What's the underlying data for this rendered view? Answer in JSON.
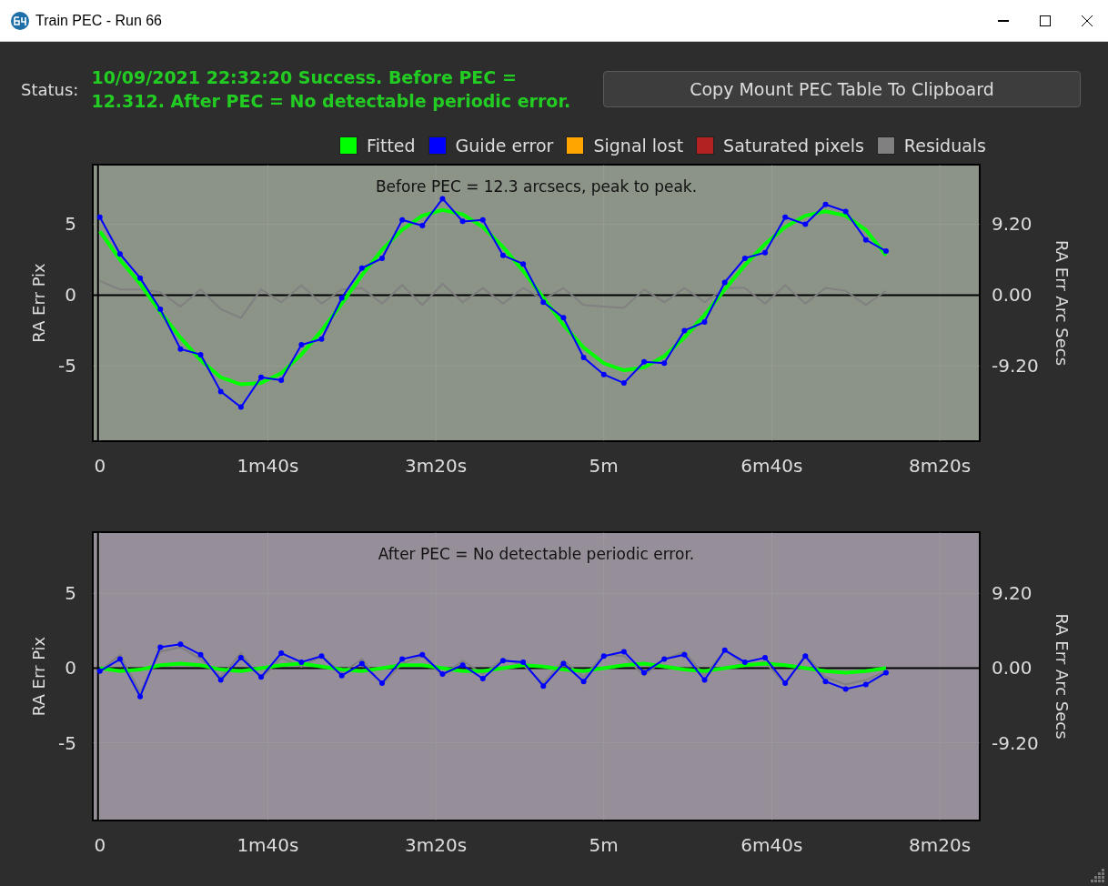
{
  "window": {
    "title": "Train PEC - Run 66"
  },
  "status": {
    "label": "Status:",
    "message": "10/09/2021 22:32:20 Success. Before PEC = 12.312. After PEC = No detectable periodic error."
  },
  "copy_button": {
    "label": "Copy Mount PEC Table To Clipboard"
  },
  "charts": [
    {
      "right_axis": {
        "label": "RA Err Arc Secs",
        "ticks": [
          "9.20",
          "0.00",
          "-9.20"
        ]
      },
      "chart_data": {
        "type": "line",
        "grid": true,
        "title": "Before PEC = 12.3 arcsecs, peak to peak.",
        "ylabel": "RA Err Pix",
        "xlim": [
          -0.07,
          8.73
        ],
        "ylim": [
          -10.3,
          9.2
        ],
        "xticks": [
          {
            "value": 0,
            "label": "0"
          },
          {
            "value": 1.6667,
            "label": "1m40s"
          },
          {
            "value": 3.3333,
            "label": "3m20s"
          },
          {
            "value": 5,
            "label": "5m"
          },
          {
            "value": 6.6667,
            "label": "6m40s"
          },
          {
            "value": 8.3333,
            "label": "8m20s"
          }
        ],
        "yticks": [
          -5,
          0,
          5
        ],
        "x": [
          0,
          0.2,
          0.4,
          0.6,
          0.8,
          1,
          1.2,
          1.4,
          1.6,
          1.8,
          2,
          2.2,
          2.4,
          2.6,
          2.8,
          3,
          3.2,
          3.4,
          3.6,
          3.8,
          4,
          4.2,
          4.4,
          4.6,
          4.8,
          5,
          5.2,
          5.4,
          5.6,
          5.8,
          6,
          6.2,
          6.4,
          6.6,
          6.8,
          7,
          7.2,
          7.4,
          7.6,
          7.8
        ],
        "series": [
          {
            "name": "Fitted",
            "color": "#00ff00",
            "values": [
              4.5,
              2.5,
              0.8,
              -1.2,
              -3.0,
              -4.6,
              -5.8,
              -6.3,
              -6.2,
              -5.5,
              -4.2,
              -2.5,
              -0.6,
              1.4,
              3.2,
              4.6,
              5.6,
              6.0,
              5.7,
              4.8,
              3.4,
              1.7,
              -0.2,
              -2.1,
              -3.7,
              -4.8,
              -5.3,
              -5.1,
              -4.3,
              -3.0,
              -1.4,
              0.4,
              2.1,
              3.6,
              4.8,
              5.6,
              5.9,
              5.6,
              4.6,
              2.8
            ]
          },
          {
            "name": "Guide error",
            "color": "#0000ff",
            "marker": "circle",
            "values": [
              5.5,
              2.9,
              1.2,
              -1.0,
              -3.8,
              -4.2,
              -6.8,
              -7.9,
              -5.8,
              -6.0,
              -3.5,
              -3.1,
              -0.2,
              1.9,
              2.6,
              5.3,
              4.9,
              6.8,
              5.2,
              5.3,
              2.8,
              2.2,
              -0.5,
              -1.6,
              -4.4,
              -5.6,
              -6.2,
              -4.7,
              -4.8,
              -2.5,
              -1.9,
              0.9,
              2.6,
              3.0,
              5.5,
              5.0,
              6.4,
              5.9,
              3.9,
              3.1
            ]
          },
          {
            "name": "Signal lost",
            "color": "#ffa500",
            "values": [
              null,
              null,
              null,
              null,
              null,
              null,
              null,
              null,
              null,
              null,
              null,
              null,
              null,
              null,
              null,
              null,
              null,
              null,
              null,
              null,
              null,
              null,
              null,
              null,
              null,
              null,
              null,
              null,
              null,
              null,
              null,
              null,
              null,
              null,
              null,
              null,
              null,
              null,
              null,
              null
            ]
          },
          {
            "name": "Saturated pixels",
            "color": "#b22222",
            "values": [
              null,
              null,
              null,
              null,
              null,
              null,
              null,
              null,
              null,
              null,
              null,
              null,
              null,
              null,
              null,
              null,
              null,
              null,
              null,
              null,
              null,
              null,
              null,
              null,
              null,
              null,
              null,
              null,
              null,
              null,
              null,
              null,
              null,
              null,
              null,
              null,
              null,
              null,
              null,
              null
            ]
          },
          {
            "name": "Residuals",
            "color": "#808080",
            "values": [
              1.0,
              0.4,
              0.4,
              0.2,
              -0.8,
              0.4,
              -1.0,
              -1.6,
              0.4,
              -0.5,
              0.7,
              -0.6,
              0.4,
              0.5,
              -0.6,
              0.7,
              -0.7,
              0.8,
              -0.5,
              0.5,
              -0.6,
              0.5,
              -0.3,
              0.5,
              -0.7,
              -0.8,
              -0.9,
              0.4,
              -0.5,
              0.5,
              -0.5,
              0.5,
              0.5,
              -0.6,
              0.7,
              -0.6,
              0.5,
              0.3,
              -0.7,
              0.3
            ]
          }
        ]
      }
    },
    {
      "right_axis": {
        "label": "RA Err Arc Secs",
        "ticks": [
          "9.20",
          "0.00",
          "-9.20"
        ]
      },
      "chart_data": {
        "type": "line",
        "grid": true,
        "title": "After PEC = No detectable periodic error.",
        "ylabel": "RA Err Pix",
        "xlim": [
          -0.07,
          8.73
        ],
        "ylim": [
          -10.2,
          9.1
        ],
        "xticks": [
          {
            "value": 0,
            "label": "0"
          },
          {
            "value": 1.6667,
            "label": "1m40s"
          },
          {
            "value": 3.3333,
            "label": "3m20s"
          },
          {
            "value": 5,
            "label": "5m"
          },
          {
            "value": 6.6667,
            "label": "6m40s"
          },
          {
            "value": 8.3333,
            "label": "8m20s"
          }
        ],
        "yticks": [
          -5,
          0,
          5
        ],
        "x": [
          0,
          0.2,
          0.4,
          0.6,
          0.8,
          1,
          1.2,
          1.4,
          1.6,
          1.8,
          2,
          2.2,
          2.4,
          2.6,
          2.8,
          3,
          3.2,
          3.4,
          3.6,
          3.8,
          4,
          4.2,
          4.4,
          4.6,
          4.8,
          5,
          5.2,
          5.4,
          5.6,
          5.8,
          6,
          6.2,
          6.4,
          6.6,
          6.8,
          7,
          7.2,
          7.4,
          7.6,
          7.8
        ],
        "series": [
          {
            "color": "#00ff00",
            "values": [
              0,
              -0.2,
              -0.1,
              0.2,
              0.3,
              0.2,
              -0.1,
              -0.2,
              0,
              0.2,
              0.3,
              0.1,
              -0.1,
              -0.2,
              0,
              0.2,
              0.2,
              0,
              -0.2,
              -0.2,
              0,
              0.2,
              0.1,
              -0.1,
              -0.2,
              0,
              0.2,
              0.3,
              0.1,
              -0.1,
              -0.2,
              0,
              0.2,
              0.3,
              0.2,
              0,
              -0.2,
              -0.3,
              -0.2,
              0
            ]
          },
          {
            "color": "#0000ff",
            "marker": "circle",
            "values": [
              -0.2,
              0.6,
              -1.9,
              1.4,
              1.6,
              0.9,
              -0.8,
              0.7,
              -0.6,
              1.0,
              0.4,
              0.8,
              -0.5,
              0.3,
              -1.0,
              0.6,
              0.9,
              -0.4,
              0.2,
              -0.7,
              0.5,
              0.4,
              -1.2,
              0.3,
              -0.9,
              0.8,
              1.1,
              -0.3,
              0.6,
              0.9,
              -0.8,
              1.2,
              0.4,
              0.7,
              -1.0,
              0.8,
              -0.9,
              -1.4,
              -1.1,
              -0.3
            ]
          },
          {
            "color": "#808080",
            "values": [
              -0.2,
              0.9,
              -1.6,
              1.1,
              1.4,
              0.6,
              -0.6,
              1.0,
              -0.7,
              0.7,
              0.1,
              0.8,
              -0.3,
              0.6,
              -1.1,
              0.3,
              0.8,
              -0.5,
              0.5,
              -0.4,
              0.6,
              0.2,
              -1.0,
              0.5,
              -0.6,
              0.9,
              0.8,
              -0.5,
              0.6,
              1.1,
              -0.5,
              1.2,
              0.2,
              0.4,
              -1.1,
              0.9,
              -0.6,
              -1.1,
              -0.8,
              -0.2
            ]
          }
        ]
      }
    }
  ]
}
